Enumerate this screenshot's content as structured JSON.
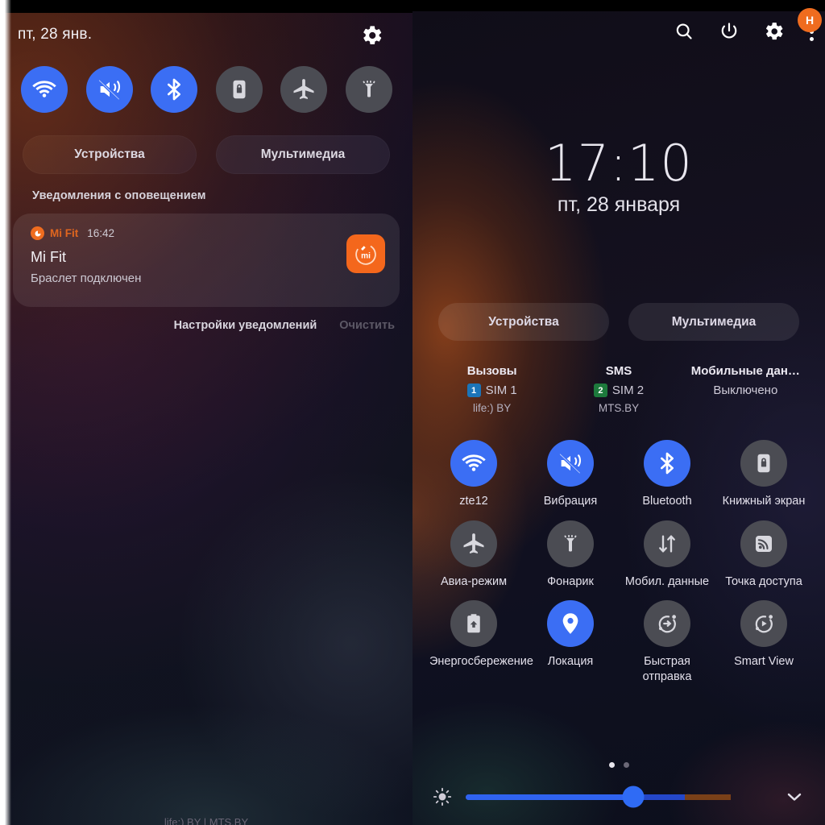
{
  "left": {
    "date": "пт, 28 янв.",
    "settings_icon": "gear-icon",
    "quick_toggles": [
      {
        "name": "wifi",
        "icon": "wifi-icon",
        "state": "on"
      },
      {
        "name": "vibrate",
        "icon": "volume-mute-vibrate-icon",
        "state": "on"
      },
      {
        "name": "bluetooth",
        "icon": "bluetooth-icon",
        "state": "on"
      },
      {
        "name": "auto-rotate-lock",
        "icon": "screen-rotation-lock-icon",
        "state": "off"
      },
      {
        "name": "airplane-mode",
        "icon": "airplane-icon",
        "state": "off"
      },
      {
        "name": "flashlight",
        "icon": "flashlight-icon",
        "state": "off"
      }
    ],
    "pills": [
      {
        "label": "Устройства"
      },
      {
        "label": "Мультимедиа"
      }
    ],
    "section_title": "Уведомления с оповещением",
    "notification": {
      "app": "Mi Fit",
      "time": "16:42",
      "title": "Mi Fit",
      "body": "Браслет подключен",
      "app_icon": "mi-fit-icon",
      "thumb_icon": "mi-fit-app-thumb"
    },
    "actions": {
      "settings": "Настройки уведомлений",
      "clear": "Очистить"
    },
    "carrier": "life:) BY | MTS.BY"
  },
  "right": {
    "header_icons": [
      {
        "name": "search-icon"
      },
      {
        "name": "power-icon"
      },
      {
        "name": "gear-icon"
      },
      {
        "name": "overflow-menu-icon"
      }
    ],
    "avatar_initial": "H",
    "clock": "17:10",
    "date": "пт, 28 января",
    "pills": [
      {
        "label": "Устройства"
      },
      {
        "label": "Мультимедиа"
      }
    ],
    "sims": [
      {
        "header": "Вызовы",
        "badge": "1",
        "badge_color": "#1b74b8",
        "label": "SIM 1",
        "sub": "life:) BY"
      },
      {
        "header": "SMS",
        "badge": "2",
        "badge_color": "#1d7a3c",
        "label": "SIM 2",
        "sub": "MTS.BY"
      },
      {
        "header": "Мобильные дан…",
        "state": "Выключено"
      }
    ],
    "tiles": [
      {
        "label": "zte12",
        "icon": "wifi-icon",
        "state": "on"
      },
      {
        "label": "Вибрация",
        "icon": "volume-mute-vibrate-icon",
        "state": "on"
      },
      {
        "label": "Bluetooth",
        "icon": "bluetooth-icon",
        "state": "on"
      },
      {
        "label": "Книжный экран",
        "icon": "screen-rotation-lock-icon",
        "state": "off"
      },
      {
        "label": "Авиа-режим",
        "icon": "airplane-icon",
        "state": "off"
      },
      {
        "label": "Фонарик",
        "icon": "flashlight-icon",
        "state": "off"
      },
      {
        "label": "Мобил. данные",
        "icon": "data-transfer-icon",
        "state": "off"
      },
      {
        "label": "Точка доступа",
        "icon": "hotspot-icon",
        "state": "off"
      },
      {
        "label": "Энергосбережение",
        "icon": "battery-saver-icon",
        "state": "off"
      },
      {
        "label": "Локация",
        "icon": "location-pin-icon",
        "state": "on"
      },
      {
        "label": "Быстрая отправка",
        "icon": "quick-share-icon",
        "state": "off"
      },
      {
        "label": "Smart View",
        "icon": "smart-view-icon",
        "state": "off"
      }
    ],
    "page_dots": {
      "count": 2,
      "active": 0
    },
    "brightness": {
      "value": 55,
      "icon": "brightness-icon",
      "expand_icon": "chevron-down-icon"
    }
  },
  "colors": {
    "accent_blue": "#3b6ef4",
    "tile_off": "#4b4c53",
    "orange": "#ef6c1f",
    "slider_blue": "#2f6bf5",
    "slider_warm": "#7a4018"
  }
}
